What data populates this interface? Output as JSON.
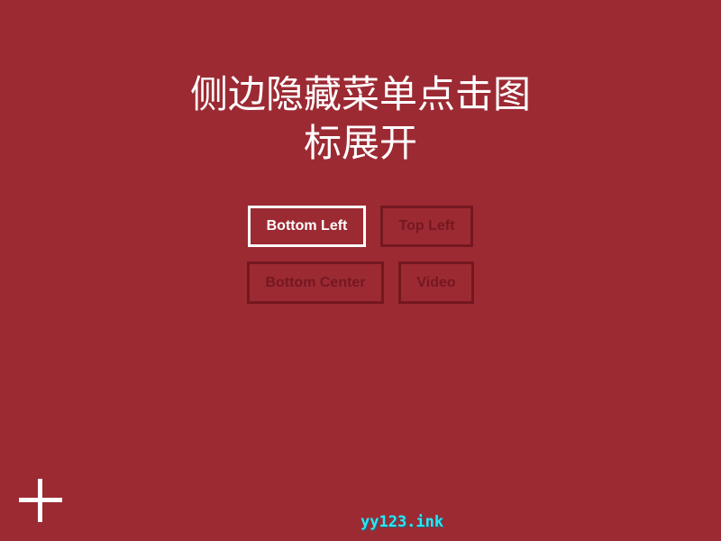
{
  "page": {
    "title_line1": "侧边隐藏菜单点击图",
    "title_line2": "标展开"
  },
  "buttons": [
    {
      "label": "Bottom Left",
      "active": true
    },
    {
      "label": "Top Left",
      "active": false
    },
    {
      "label": "Bottom Center",
      "active": false
    },
    {
      "label": "Video",
      "active": false
    }
  ],
  "menu_toggle": {
    "icon": "plus-icon"
  },
  "watermark": {
    "text": "yy123.ink"
  },
  "colors": {
    "background": "#9c2a33",
    "active": "#ffffff",
    "inactive": "#741820",
    "watermark": "#2fe6f2"
  }
}
